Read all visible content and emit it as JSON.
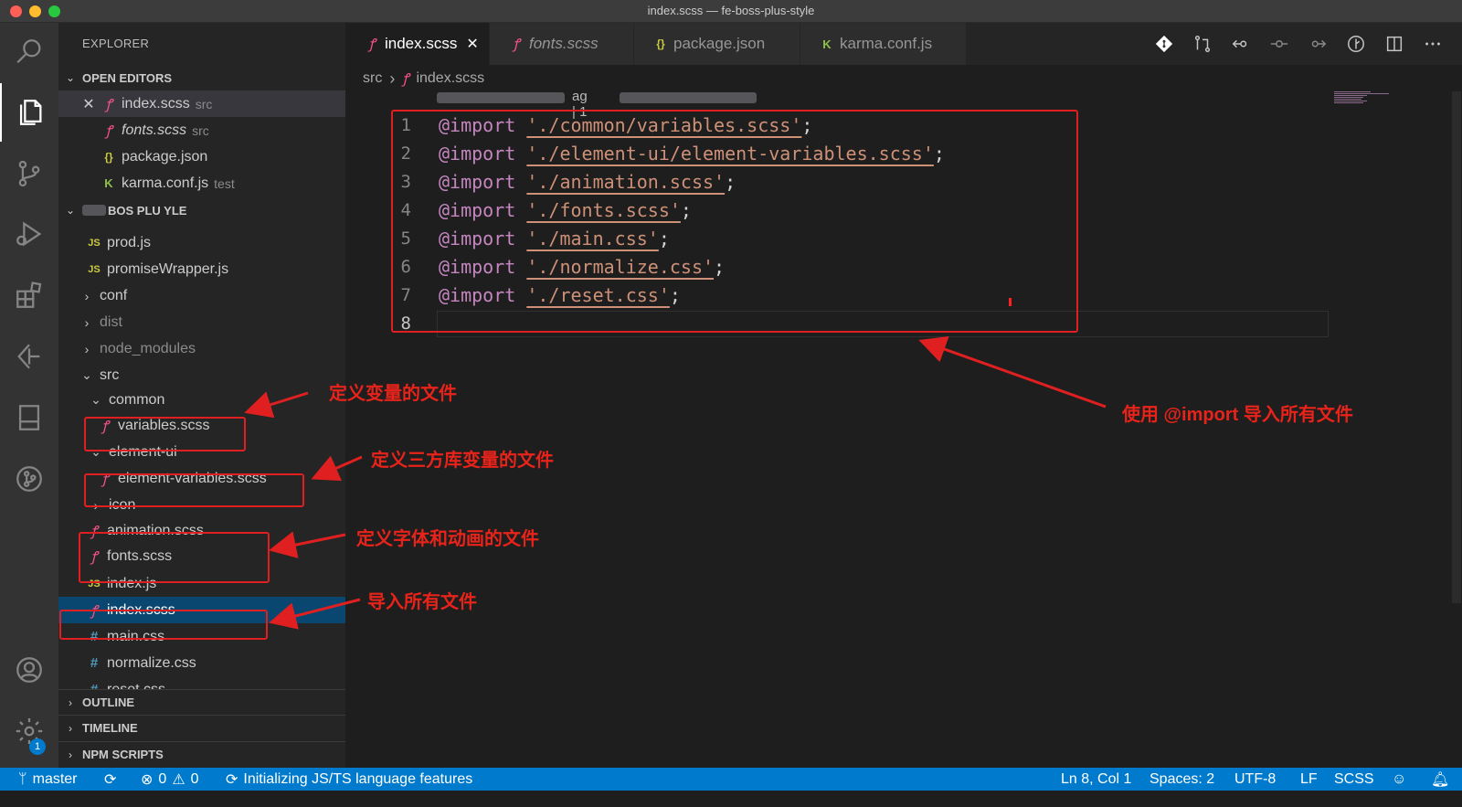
{
  "window": {
    "title": "index.scss — fe-boss-plus-style"
  },
  "activity_bar": {
    "items": [
      "search",
      "explorer",
      "source-control",
      "run-debug",
      "extensions",
      "remote",
      "bookmarks",
      "git-graph"
    ],
    "settings_badge": "1"
  },
  "explorer": {
    "title": "EXPLORER",
    "open_editors_label": "OPEN EDITORS",
    "open_editors": [
      {
        "name": "index.scss",
        "desc": "src",
        "icon": "sass-icon",
        "active": true
      },
      {
        "name": "fonts.scss",
        "desc": "src",
        "icon": "sass-icon",
        "italic": true
      },
      {
        "name": "package.json",
        "desc": "",
        "icon": "json-icon"
      },
      {
        "name": "karma.conf.js",
        "desc": "test",
        "icon": "karma-icon"
      }
    ],
    "project_label": "BOS PLU YLE",
    "tree": [
      {
        "name": "prod.js",
        "icon": "js"
      },
      {
        "name": "promiseWrapper.js",
        "icon": "js"
      },
      {
        "name": "conf",
        "icon": "folder-closed"
      },
      {
        "name": "dist",
        "icon": "folder-closed",
        "dim": true
      },
      {
        "name": "node_modules",
        "icon": "folder-closed",
        "dim": true
      },
      {
        "name": "src",
        "icon": "folder-open"
      },
      {
        "name": "common",
        "icon": "folder-open"
      },
      {
        "name": "variables.scss",
        "icon": "sass"
      },
      {
        "name": "element-ui",
        "icon": "folder-open"
      },
      {
        "name": "element-variables.scss",
        "icon": "sass"
      },
      {
        "name": "icon",
        "icon": "folder-closed"
      },
      {
        "name": "animation.scss",
        "icon": "sass"
      },
      {
        "name": "fonts.scss",
        "icon": "sass"
      },
      {
        "name": "index.js",
        "icon": "js"
      },
      {
        "name": "index.scss",
        "icon": "sass",
        "selected": true
      },
      {
        "name": "main.css",
        "icon": "css"
      },
      {
        "name": "normalize.css",
        "icon": "css"
      },
      {
        "name": "reset.css",
        "icon": "css"
      }
    ],
    "bottom_sections": [
      "OUTLINE",
      "TIMELINE",
      "NPM SCRIPTS"
    ]
  },
  "tabs": [
    {
      "label": "index.scss",
      "active": true,
      "icon": "sass"
    },
    {
      "label": "fonts.scss",
      "italic": true,
      "icon": "sass"
    },
    {
      "label": "package.json",
      "icon": "json"
    },
    {
      "label": "karma.conf.js",
      "icon": "karma"
    }
  ],
  "breadcrumb": [
    "src",
    "index.scss"
  ],
  "sticky_fragment": "ag | 1",
  "code": {
    "keyword": "@import",
    "lines": [
      "'./common/variables.scss'",
      "'./element-ui/element-variables.scss'",
      "'./animation.scss'",
      "'./fonts.scss'",
      "'./main.css'",
      "'./normalize.css'",
      "'./reset.css'"
    ],
    "line_numbers": [
      "1",
      "2",
      "3",
      "4",
      "5",
      "6",
      "7",
      "8"
    ],
    "current_line": 8
  },
  "status": {
    "branch": "master",
    "errors": "0",
    "warnings": "0",
    "message": "Initializing JS/TS language features",
    "position": "Ln 8, Col 1",
    "spaces": "Spaces: 2",
    "encoding": "UTF-8",
    "eol": "LF",
    "language": "SCSS"
  },
  "annotations": {
    "variables": "定义变量的文件",
    "third_party": "定义三方库变量的文件",
    "fonts_anim": "定义字体和动画的文件",
    "import_all": "导入所有文件",
    "use_import": "使用 @import 导入所有文件"
  },
  "colors": {
    "annotation": "#e02020",
    "statusbar": "#007acc",
    "selection": "#094771",
    "keyword": "#c586c0",
    "string": "#ce9178"
  }
}
